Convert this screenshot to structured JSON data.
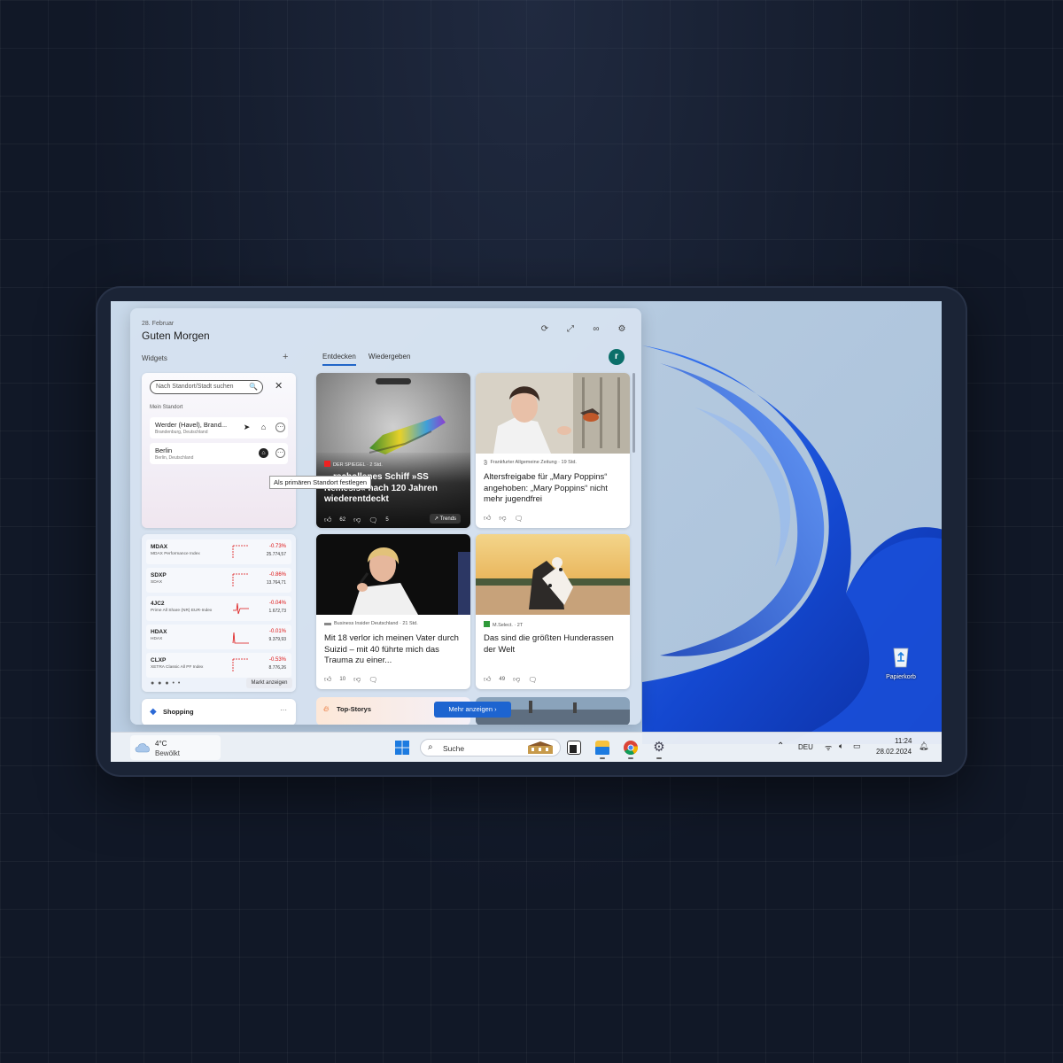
{
  "panel": {
    "date": "28. Februar",
    "greeting": "Guten Morgen",
    "widgets_label": "Widgets",
    "add_icon": "+",
    "tabs": [
      {
        "label": "Entdecken"
      },
      {
        "label": "Wiedergeben"
      }
    ],
    "avatar_letter": "r"
  },
  "location": {
    "search_placeholder": "Nach Standort/Stadt suchen",
    "section": "Mein Standort",
    "items": [
      {
        "name": "Werder (Havel), Brand...",
        "sub": "Brandenburg, Deutschland"
      },
      {
        "name": "Berlin",
        "sub": "Berlin, Deutschland"
      }
    ],
    "tooltip": "Als primären Standort festlegen"
  },
  "market": {
    "rows": [
      {
        "symbol": "MDAX",
        "name": "MDAX Performance Index",
        "change": "-0.73%",
        "value": "25.774,57"
      },
      {
        "symbol": "SDXP",
        "name": "SDAX",
        "change": "-0.86%",
        "value": "13.764,71"
      },
      {
        "symbol": "4JC2",
        "name": "Prime All Share (NR) EUR-Index",
        "change": "-0.04%",
        "value": "1.672,73"
      },
      {
        "symbol": "HDAX",
        "name": "HDAX",
        "change": "-0.01%",
        "value": "9.379,93"
      },
      {
        "symbol": "CLXP",
        "name": "XETRA Classic All PF Index",
        "change": "-0.53%",
        "value": "8.776,26"
      }
    ],
    "button": "Markt anzeigen"
  },
  "shopping": {
    "label": "Shopping",
    "more": "···"
  },
  "news": [
    {
      "source": "DER SPIEGEL · 2 Std.",
      "headline": "…rschollenes Schiff »SS Nemesis« nach 120 Jahren wiederentdeckt",
      "likes": "62",
      "comments": "5",
      "badge": "Trends"
    },
    {
      "source": "Frankfurter Allgemeine Zeitung · 19 Std.",
      "headline": "Altersfreigabe für „Mary Poppins“ angehoben: „Mary Poppins“ nicht mehr jugendfrei"
    },
    {
      "source": "Business Insider Deutschland · 21 Std.",
      "headline": "Mit 18 verlor ich meinen Vater durch Suizid – mit 40 führte mich das Trauma zu einer...",
      "likes": "10"
    },
    {
      "source": "M.Select. · 2T",
      "headline": "Das sind die größten Hunderassen der Welt",
      "likes": "49"
    }
  ],
  "top_stories": {
    "label": "Top-Storys",
    "button": "Mehr anzeigen"
  },
  "desktop": {
    "recycle_bin": "Papierkorb"
  },
  "taskbar": {
    "weather_temp": "4°C",
    "weather_cond": "Bewölkt",
    "search": "Suche",
    "language": "DEU",
    "time": "11:24",
    "date": "28.02.2024"
  },
  "colors": {
    "accent": "#1d64d0",
    "negative": "#dd1111"
  }
}
